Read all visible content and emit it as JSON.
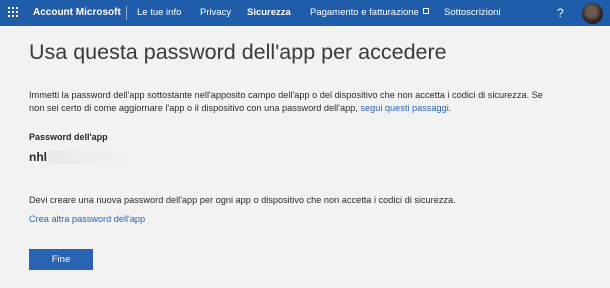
{
  "header": {
    "brand": "Account Microsoft",
    "nav": [
      {
        "label": "Le tue info"
      },
      {
        "label": "Privacy"
      },
      {
        "label": "Sicurezza",
        "active": true
      },
      {
        "label": "Pagamento e fatturazione",
        "external": true
      },
      {
        "label": "Sottoscrizioni"
      }
    ],
    "help_label": "?"
  },
  "main": {
    "title": "Usa questa password dell'app per accedere",
    "intro_line1": "Immetti la password dell'app sottostante nell'apposito campo dell'app o del dispositivo che non accetta i codici di sicurezza. Se",
    "intro_line2": "non sei certo di come aggiornare l'app o il dispositivo con una password dell'app, ",
    "intro_link": "segui questi passaggi",
    "intro_end": ".",
    "password_label": "Password dell'app",
    "password_value": "nhl",
    "note": "Devi creare una nuova password dell'app per ogni app o dispositivo che non accetta i codici di sicurezza.",
    "create_link": "Crea altra password dell'app",
    "done_button": "Fine"
  },
  "colors": {
    "header_bg": "#1f5ca9",
    "accent": "#2b63b3",
    "page_bg": "#f2f2f2"
  }
}
